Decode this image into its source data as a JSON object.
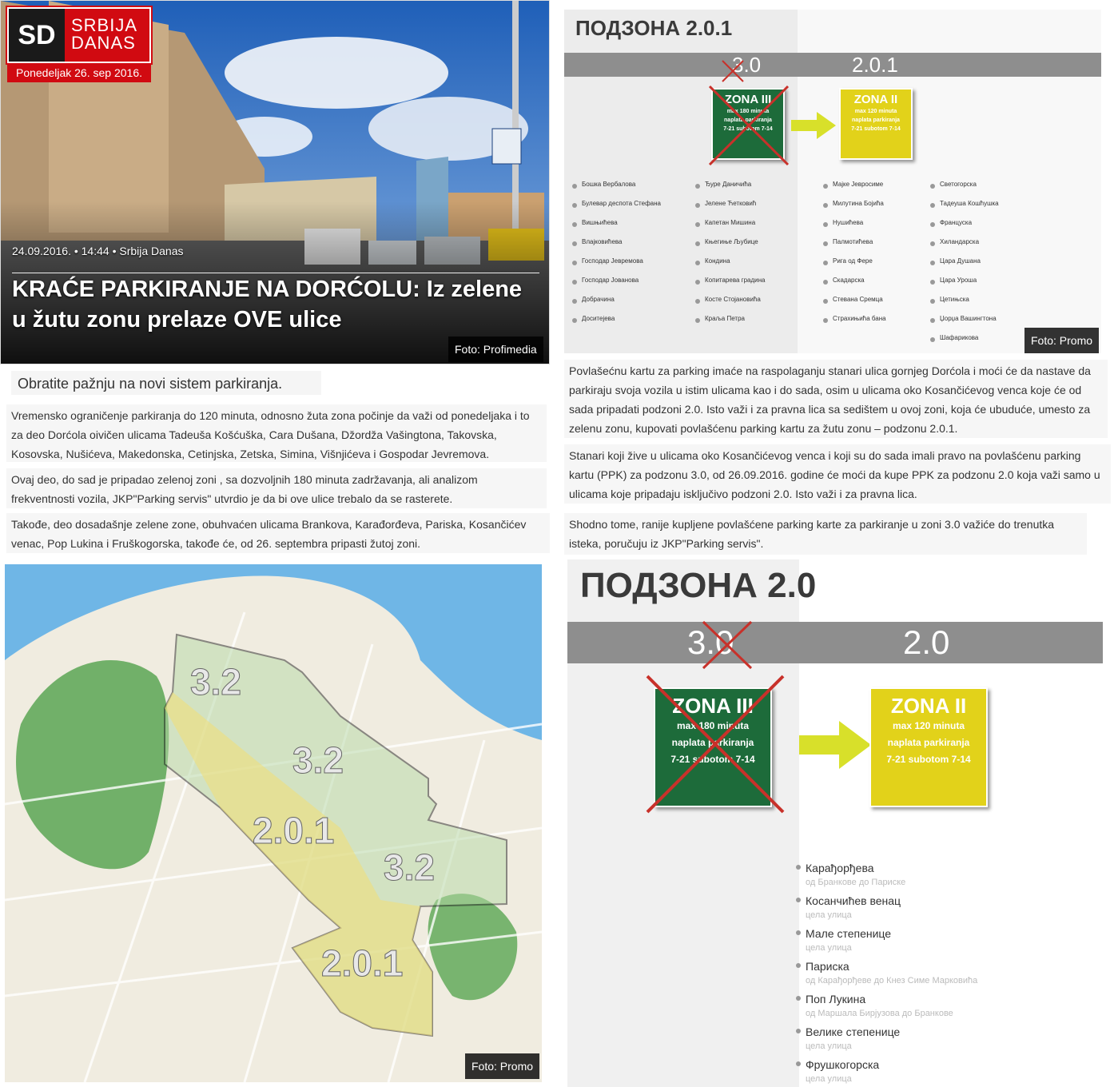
{
  "brand": {
    "logo_initials": "SD",
    "logo_line1": "SRBIJA",
    "logo_line2": "DANAS",
    "date": "Ponedeljak 26. sep 2016."
  },
  "article": {
    "meta": "24.09.2016. • 14:44 • Srbija Danas",
    "title": "KRAĆE PARKIRANJE NA DORĆOLU: Iz zelene u žutu zonu prelaze OVE ulice",
    "hero_credit": "Foto: Profimedia",
    "lead": "Obratite pažnju na novi sistem parkiranja.",
    "p1": "Vremensko ograničenje parkiranja do 120 minuta, odnosno žuta zona počinje da važi od ponedeljaka i to za deo Dorćola oivičen ulicama Tadeuša Košćuška, Cara Dušana, Džordža Vašingtona, Takovska, Kosovska, Nušićeva, Makedonska, Cetinjska, Zetska, Simina, Višnjićeva i Gospodar Jevremova.",
    "p2": "Ovaj deo, do sad je pripadao zelenoj zoni , sa dozvoljnih 180 minuta zadržavanja, ali analizom frekventnosti vozila, JKP\"Parking servis\" utvrdio je da bi ove ulice trebalo da se rasterete.",
    "p3": "Takođe, deo dosadašnje zelene zone, obuhvaćen ulicama Brankova, Karađorđeva, Pariska, Kosančićev venac, Pop Lukina i Fruškogorska, takođe će, od 26. septembra pripasti žutoj zoni.",
    "p4": "Povlašećnu kartu za parking imaće na raspolaganju stanari ulica gornjeg Dorćola i moći će da nastave da parkiraju svoja vozila u istim ulicama kao i do sada, osim u ulicama oko Kosančićevog venca koje će od sada pripadati podzoni 2.0. Isto važi i za pravna lica sa sedištem u ovoj zoni, koja će ubuduće, umesto za zelenu zonu, kupovati povlašćenu parking kartu za žutu zonu – podzonu 2.0.1.",
    "p5": "Stanari koji žive u ulicama oko Kosančićevog venca i koji su do sada imali pravo na povlašćenu parking kartu (PPK) za podzonu 3.0, od 26.09.2016. godine će moći da kupe PPK za podzonu 2.0 koja važi samo u ulicama koje pripadaju isključivo podzoni 2.0. Isto važi i za pravna lica.",
    "p6": "Shodno tome, ranije kupljene povlašćene parking karte za parkiranje u zoni 3.0 važiće do trenutka isteka, poručuju iz JKP\"Parking servis\"."
  },
  "infographic1": {
    "title": "ПОДЗОНА 2.0.1",
    "old_zone": "3.0",
    "new_zone": "2.0.1",
    "credit": "Foto: Promo",
    "sign_old": {
      "name": "ZONA III",
      "l1": "max 180 minuta",
      "l2": "naplata parkiranja",
      "l3": "7-21 subotom 7-14"
    },
    "sign_new": {
      "name": "ZONA II",
      "l1": "max 120 minuta",
      "l2": "naplata parkiranja",
      "l3": "7-21 subotom 7-14"
    },
    "col1": [
      "Бошка Вербалова",
      "Булевар деспота Стефана",
      "Вишњићева",
      "Влајковићева",
      "Господар Јевремова",
      "Господар Јованова",
      "Добрачина",
      "Доситејева"
    ],
    "col2": [
      "Ђуре Даничића",
      "Јелене Ћетковић",
      "Капетан Мишина",
      "Књегиње Љубице",
      "Кондина",
      "Копитарева градина",
      "Косте Стојановића",
      "Краља Петра"
    ],
    "col3": [
      "Мајке Јевросиме",
      "Милутина Бојића",
      "Нушићева",
      "Палмотићева",
      "Рига од Фере",
      "Скадарска",
      "Стевана Сремца",
      "Страхињића бана"
    ],
    "col4": [
      "Светогорска",
      "Тадеуша Кошћушка",
      "Француска",
      "Хиландарска",
      "Цара Душана",
      "Цара Уроша",
      "Цетињска",
      "Џорџа Вашингтона",
      "Шафарикова"
    ]
  },
  "map": {
    "labels": [
      "3.2",
      "3.2",
      "2.0.1",
      "3.2",
      "2.0.1"
    ],
    "credit": "Foto: Promo"
  },
  "infographic2": {
    "title": "ПОДЗОНА 2.0",
    "old_zone": "3.0",
    "new_zone": "2.0",
    "sign_old": {
      "name": "ZONA III",
      "l1": "max 180 minuta",
      "l2": "naplata parkiranja",
      "l3": "7-21 subotom 7-14"
    },
    "sign_new": {
      "name": "ZONA II",
      "l1": "max 120 minuta",
      "l2": "naplata parkiranja",
      "l3": "7-21 subotom 7-14"
    },
    "streets": [
      {
        "name": "Карађорђева",
        "sub": "од Бранкове до Париске"
      },
      {
        "name": "Косанчићев венац",
        "sub": "цела улица"
      },
      {
        "name": "Мале степенице",
        "sub": "цела улица"
      },
      {
        "name": "Париска",
        "sub": "од Карађорђеве до Кнез Симе Марковића"
      },
      {
        "name": "Поп Лукина",
        "sub": "од Маршала Бирјузова до Бранкове"
      },
      {
        "name": "Велике степенице",
        "sub": "цела улица"
      },
      {
        "name": "Фрушкогорска",
        "sub": "цела улица"
      }
    ]
  },
  "colors": {
    "brand": "#d10a11",
    "zone_green": "#1d6b3a",
    "zone_yellow": "#e2d21a",
    "map_water": "#6fb6e6",
    "map_land": "#f0ece0",
    "park": "#5aa653"
  }
}
